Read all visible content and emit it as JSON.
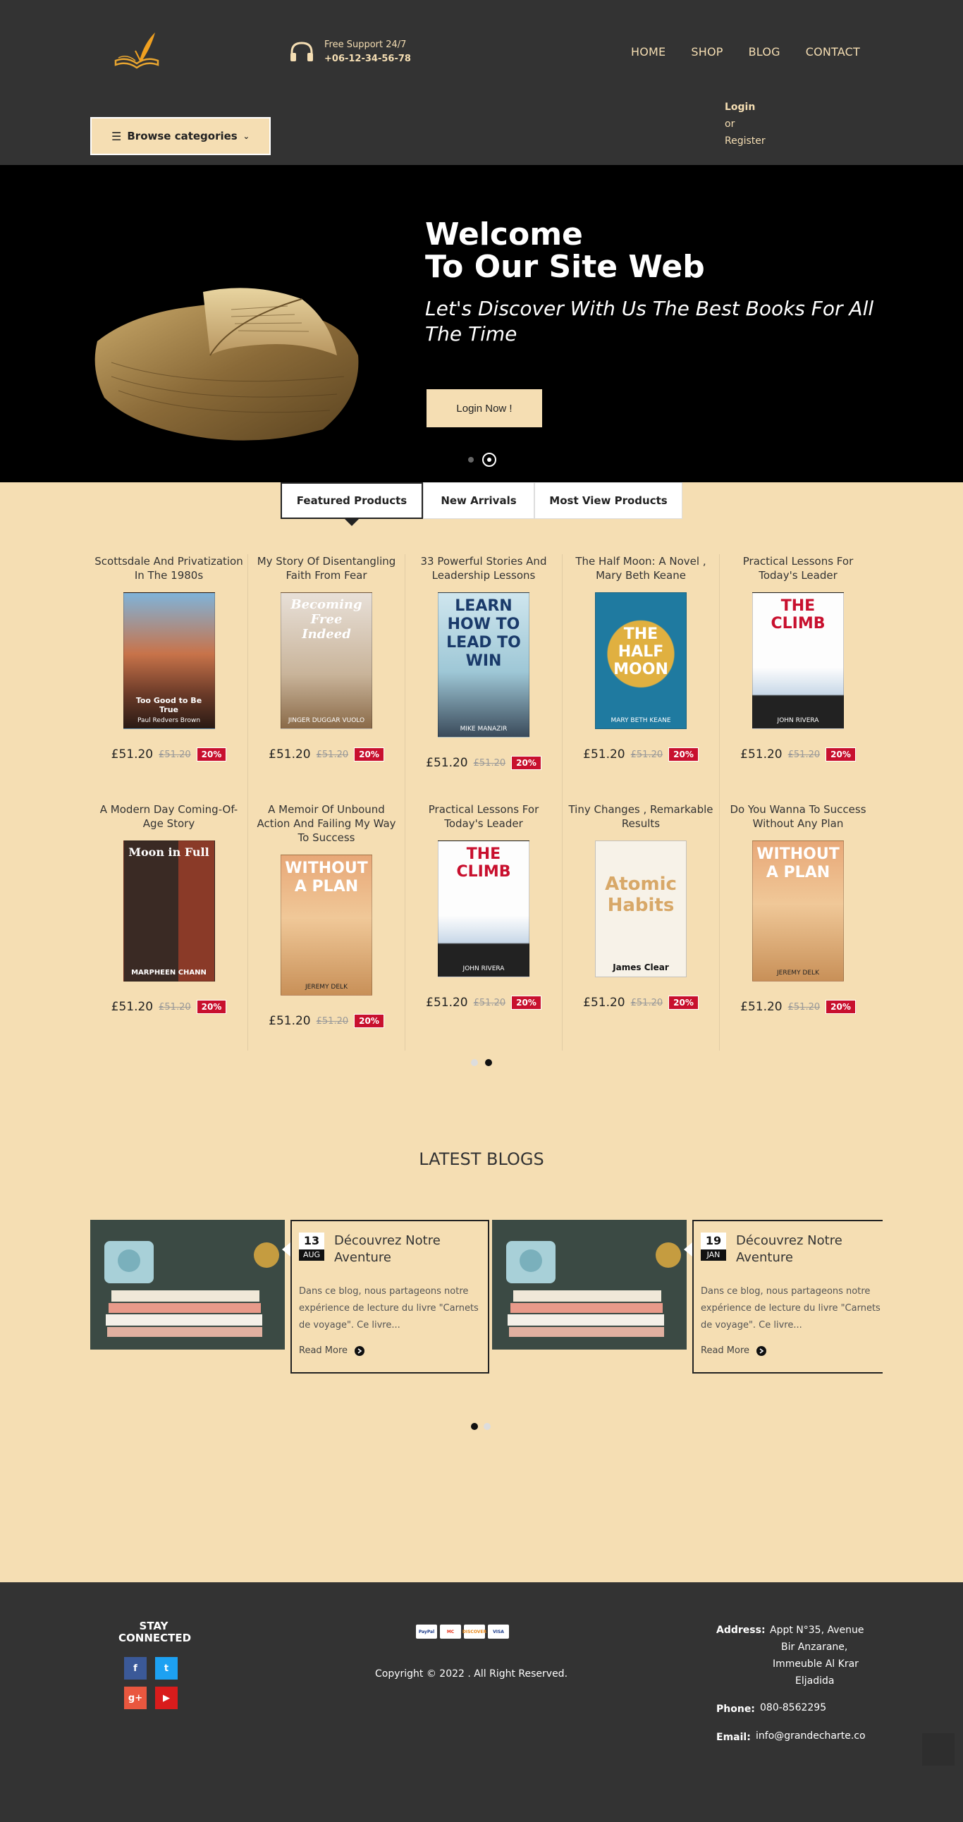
{
  "header": {
    "support_label": "Free Support 24/7",
    "support_phone": "+06-12-34-56-78",
    "nav": [
      "HOME",
      "SHOP",
      "BLOG",
      "CONTACT"
    ],
    "account": {
      "login": "Login",
      "or": "or",
      "register": "Register"
    },
    "browse_label": "Browse categories"
  },
  "hero": {
    "title_line1": "Welcome",
    "title_line2": "To Our Site Web",
    "subtitle": "Let's Discover With Us The Best Books For All The Time",
    "button": "Login Now !"
  },
  "tabs": [
    "Featured Products",
    "New Arrivals",
    "Most View Products"
  ],
  "products": [
    {
      "title": "Scottsdale And Privatization In The 1980s",
      "cover_title": "Too Good to Be True",
      "cover_author": "Paul Redvers Brown",
      "price": "£51.20",
      "old_price": "£51.20",
      "discount": "20%"
    },
    {
      "title": "My Story Of Disentangling Faith From Fear",
      "cover_title": "Becoming Free Indeed",
      "cover_author": "JINGER DUGGAR VUOLO",
      "price": "£51.20",
      "old_price": "£51.20",
      "discount": "20%"
    },
    {
      "title": "33 Powerful Stories And Leadership Lessons",
      "cover_title": "LEARN HOW TO LEAD TO WIN",
      "cover_author": "MIKE MANAZIR",
      "price": "£51.20",
      "old_price": "£51.20",
      "discount": "20%"
    },
    {
      "title": "The Half Moon: A Novel , Mary Beth Keane",
      "cover_title": "THE HALF MOON",
      "cover_author": "MARY BETH KEANE",
      "price": "£51.20",
      "old_price": "£51.20",
      "discount": "20%"
    },
    {
      "title": "Practical Lessons For Today's Leader",
      "cover_title": "THE CLIMB",
      "cover_author": "JOHN RIVERA",
      "price": "£51.20",
      "old_price": "£51.20",
      "discount": "20%"
    },
    {
      "title": "A Modern Day Coming-Of-Age Story",
      "cover_title": "Moon in Full",
      "cover_author": "MARPHEEN CHANN",
      "price": "£51.20",
      "old_price": "£51.20",
      "discount": "20%"
    },
    {
      "title": "A Memoir Of Unbound Action And Failing My Way To Success",
      "cover_title": "WITHOUT A PLAN",
      "cover_author": "JEREMY DELK",
      "price": "£51.20",
      "old_price": "£51.20",
      "discount": "20%"
    },
    {
      "title": "Practical Lessons For Today's Leader",
      "cover_title": "THE CLIMB",
      "cover_author": "JOHN RIVERA",
      "price": "£51.20",
      "old_price": "£51.20",
      "discount": "20%"
    },
    {
      "title": "Tiny Changes , Remarkable Results",
      "cover_title": "Atomic Habits",
      "cover_author": "James Clear",
      "price": "£51.20",
      "old_price": "£51.20",
      "discount": "20%"
    },
    {
      "title": "Do You Wanna To Success Without Any Plan",
      "cover_title": "WITHOUT A PLAN",
      "cover_author": "JEREMY DELK",
      "price": "£51.20",
      "old_price": "£51.20",
      "discount": "20%"
    }
  ],
  "blogs_title": "LATEST BLOGS",
  "blogs": [
    {
      "day": "13",
      "month": "AUG",
      "title": "Découvrez Notre Aventure",
      "excerpt": "Dans ce blog, nous partageons notre expérience de lecture du livre \"Carnets de voyage\". Ce livre...",
      "more": "Read More"
    },
    {
      "day": "19",
      "month": "JAN",
      "title": "Découvrez Notre Aventure",
      "excerpt": "Dans ce blog, nous partageons notre expérience de lecture du livre \"Carnets de voyage\". Ce livre...",
      "more": "Read More"
    }
  ],
  "footer": {
    "stay_connected": "STAY CONNECTED",
    "social": [
      "f",
      "t",
      "g+",
      "▶"
    ],
    "payment": [
      "PayPal",
      "MC",
      "DISCOVER",
      "VISA"
    ],
    "copyright": "Copyright © 2022 . All Right Reserved.",
    "address_label": "Address:",
    "address_lines": [
      "Appt N°35, Avenue",
      "Bir Anzarane,",
      "Immeuble Al Krar",
      "Eljadida"
    ],
    "phone_label": "Phone:",
    "phone": "080-8562295",
    "email_label": "Email:",
    "email": "info@grandecharte.co"
  },
  "colors": {
    "accent": "#f5deb3",
    "dark": "#333333",
    "sale": "#c8102e"
  }
}
